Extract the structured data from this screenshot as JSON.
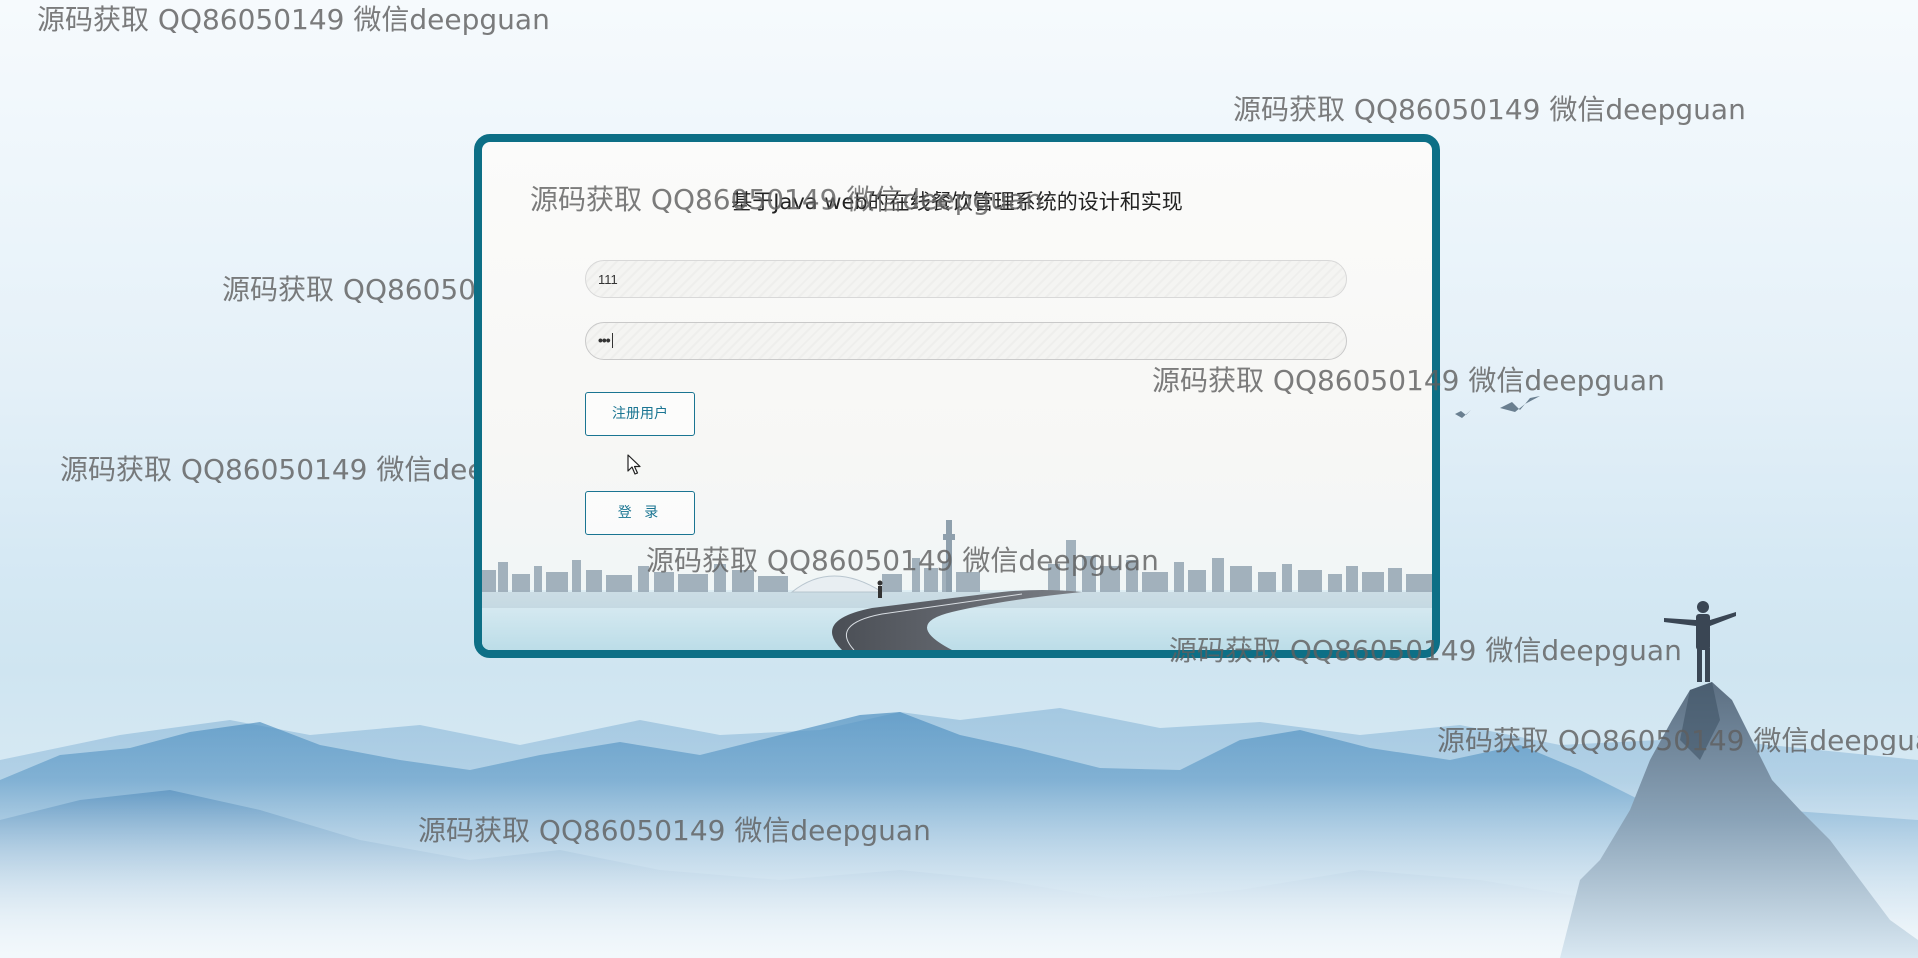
{
  "app": {
    "title": "基于Java web的在线餐饮管理系统的设计和实现"
  },
  "login_form": {
    "username_value": "111",
    "password_value": "•••",
    "register_label": "注册用户",
    "login_label": "登 录"
  },
  "watermark": {
    "text": "源码获取 QQ86050149 微信deepguan"
  },
  "colors": {
    "accent": "#0d6f86",
    "button_text": "#1a7592"
  },
  "icons": {
    "cursor": "arrow-cursor-icon"
  }
}
